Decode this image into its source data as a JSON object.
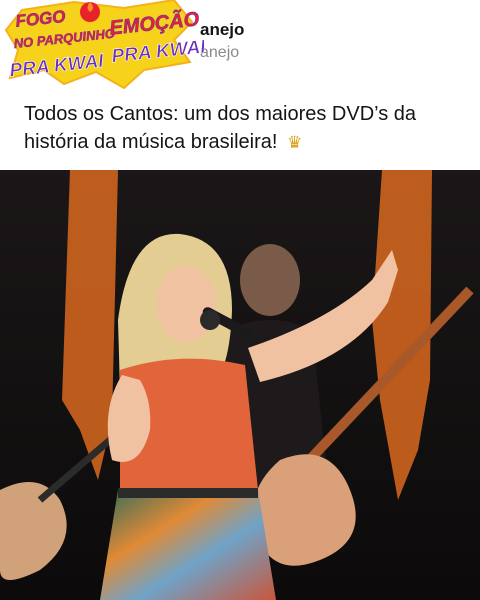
{
  "post": {
    "author_line1": "anejo",
    "author_line2": "anejo",
    "caption": "Todos os Cantos: um dos maiores DVD’s da história da música brasileira!",
    "caption_emoji": "crown-icon"
  },
  "sticker": {
    "line1": "FOGO",
    "line2": "NO PARQUINHO",
    "line3": "PRA KWAI",
    "badge_line1": "EMOÇÃO",
    "badge_line2": "PRA KWAI"
  },
  "colors": {
    "text_primary": "#151515",
    "text_secondary": "#8a8a8a",
    "sticker_yellow": "#f7d21a",
    "sticker_red": "#e8222a",
    "sticker_purple": "#6a2fb6",
    "background": "#ffffff"
  }
}
